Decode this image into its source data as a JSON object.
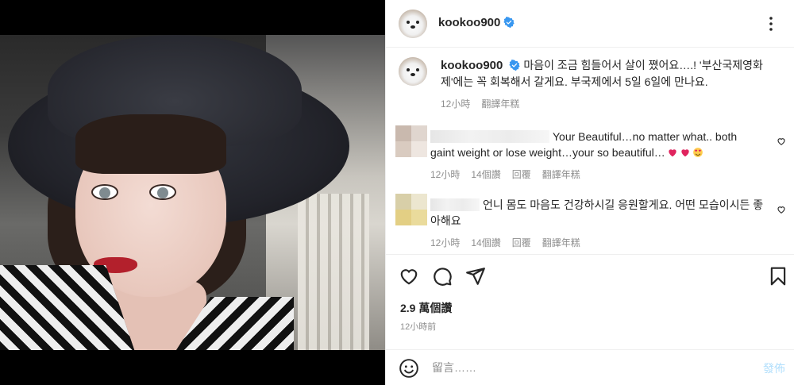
{
  "post": {
    "username": "kookoo900",
    "verified": true,
    "caption": "마음이 조금 힘들어서 살이 쪘어요….! '부산국제영화제'에는 꼭 회복해서 갈게요. 부국제에서 5일 6일에 만나요.",
    "caption_time": "12小時",
    "caption_translate": "翻譯年糕"
  },
  "comments": [
    {
      "text": "Your Beautiful…no matter what.. both gaint weight or lose weight…your so beautiful…",
      "time": "12小時",
      "likes": "14個讚",
      "reply": "回覆",
      "translate": "翻譯年糕",
      "emojis": [
        "heart-red-icon",
        "heart-red-icon",
        "smiling-hearts-face-icon"
      ],
      "mosaic_colors": [
        "#c9b9ae",
        "#e0d6cf",
        "#d9cbc0",
        "#eee6e0"
      ]
    },
    {
      "text": "언니 몸도 마음도 건강하시길 응원할게요. 어떤 모습이시든 좋아해요",
      "time": "12小時",
      "likes": "14個讚",
      "reply": "回覆",
      "translate": "翻譯年糕",
      "mosaic_colors": [
        "#d8cfa8",
        "#ece6cf",
        "#e3cf84",
        "#eadb9c"
      ]
    }
  ],
  "stats": {
    "views": "2.9 萬個讚",
    "time_ago": "12小時前"
  },
  "composer": {
    "placeholder": "留言……",
    "post_label": "發佈"
  },
  "colors": {
    "verified": "#3897f0",
    "heart": "#ed4956",
    "muted": "#8e8e8e",
    "post_disabled": "#b2dffc"
  }
}
